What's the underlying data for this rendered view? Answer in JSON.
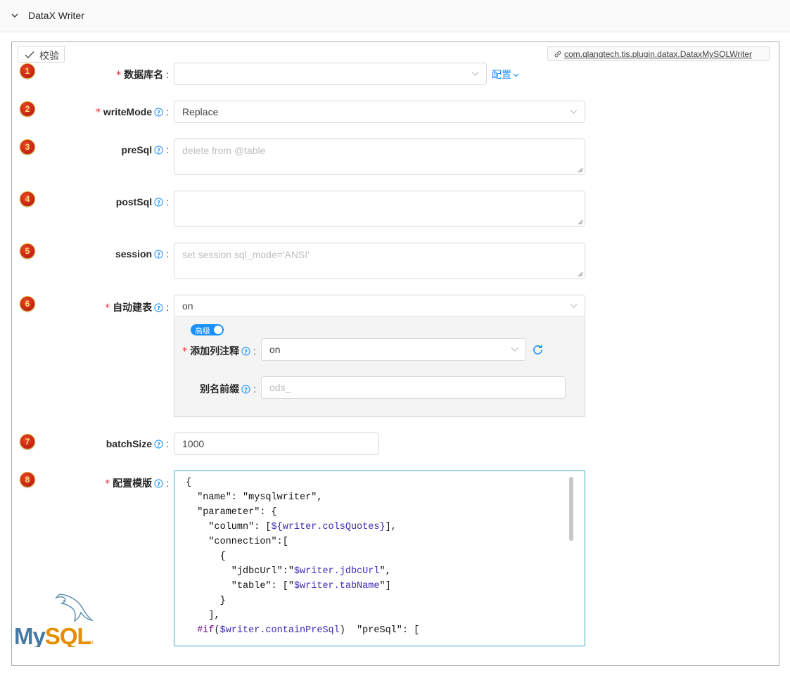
{
  "header": {
    "title": "DataX Writer"
  },
  "toolbar": {
    "validate_label": "校验",
    "plugin_name": "com.qlangtech.tis.plugin.datax.DataxMySQLWriter"
  },
  "badges": [
    "1",
    "2",
    "3",
    "4",
    "5",
    "6",
    "7",
    "8"
  ],
  "fields": {
    "dbName": {
      "label": "数据库名",
      "value": "",
      "config_link": "配置"
    },
    "writeMode": {
      "label": "writeMode",
      "value": "Replace"
    },
    "preSql": {
      "label": "preSql",
      "placeholder": "delete from @table"
    },
    "postSql": {
      "label": "postSql",
      "placeholder": ""
    },
    "session": {
      "label": "session",
      "placeholder": "set session sql_mode='ANSI'"
    },
    "autoCreateTable": {
      "label": "自动建表",
      "value": "on",
      "advanced_label": "高级",
      "addComment": {
        "label": "添加列注释",
        "value": "on"
      },
      "aliasPrefix": {
        "label": "别名前缀",
        "placeholder": "ods_"
      }
    },
    "batchSize": {
      "label": "batchSize",
      "value": "1000"
    },
    "template": {
      "label": "配置模版",
      "lines": [
        [
          "{"
        ],
        [
          "  \"name\": \"mysqlwriter\","
        ],
        [
          "  \"parameter\": {"
        ],
        [
          "    \"column\": [",
          "${writer.colsQuotes}",
          "],"
        ],
        [
          "    \"connection\":["
        ],
        [
          "      {"
        ],
        [
          "        \"jdbcUrl\":\"",
          "$writer.jdbcUrl",
          "\","
        ],
        [
          "        \"table\": [\"",
          "$writer.tabName",
          "\"]"
        ],
        [
          "      }"
        ],
        [
          "    ],"
        ],
        [
          "  ",
          "#if",
          "(",
          "$writer.containPreSql",
          ")  \"preSql\": ["
        ]
      ]
    }
  },
  "logo": {
    "text": "MySQL",
    "tm": "TM"
  },
  "colors": {
    "accent": "#1890ff",
    "required": "#f5222d",
    "border": "#d9d9d9",
    "variable": "#3a2bb5",
    "keyword": "#6b0f8e"
  }
}
